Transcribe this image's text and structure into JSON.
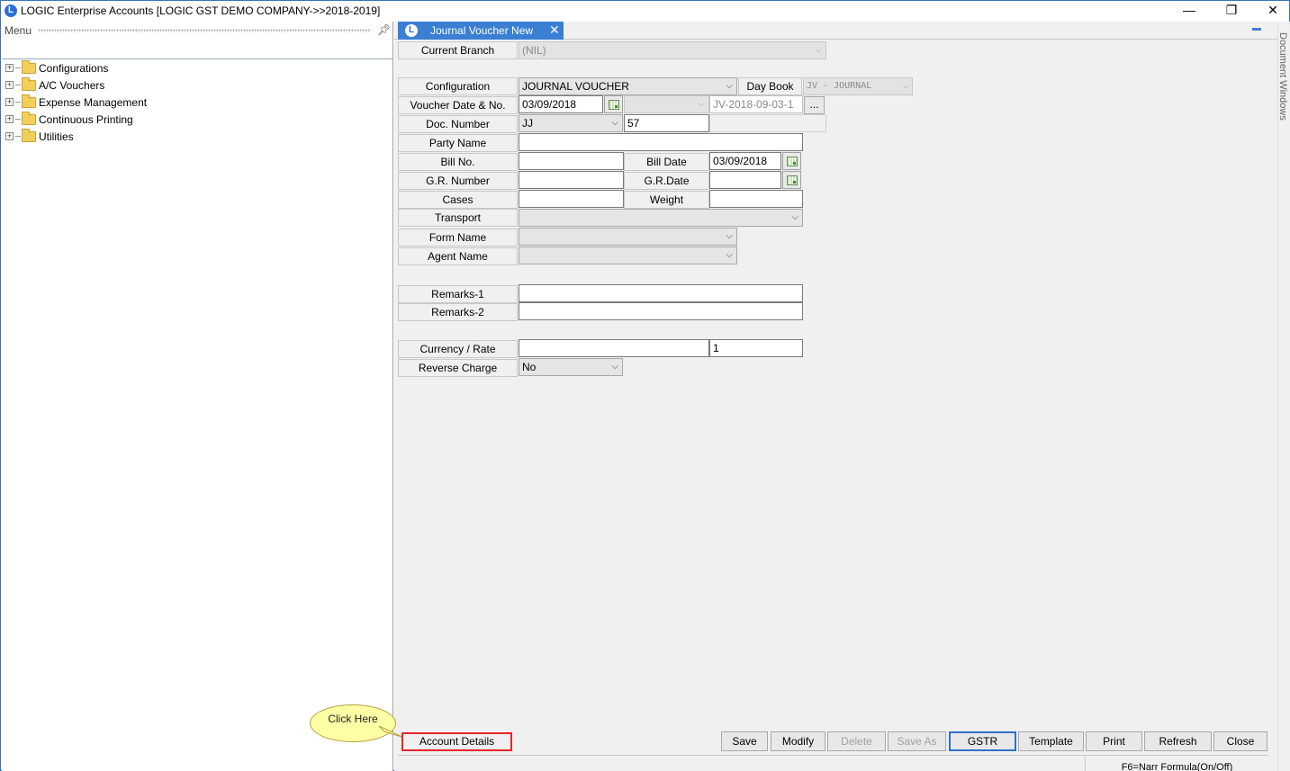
{
  "window": {
    "title": "LOGIC Enterprise Accounts  [LOGIC GST DEMO COMPANY->>2018-2019]",
    "minimize": "—",
    "maximize": "❐",
    "close": "✕"
  },
  "menu": {
    "title": "Menu",
    "items": [
      {
        "label": "Configurations"
      },
      {
        "label": "A/C Vouchers"
      },
      {
        "label": "Expense Management"
      },
      {
        "label": "Continuous Printing"
      },
      {
        "label": "Utilities"
      }
    ]
  },
  "tab": {
    "title": "Journal Voucher New",
    "side_label": "Document Windows"
  },
  "form": {
    "current_branch_label": "Current Branch",
    "current_branch_value": "(NIL)",
    "configuration_label": "Configuration",
    "configuration_value": "JOURNAL VOUCHER",
    "day_book_label": "Day Book",
    "day_book_value": "JV - JOURNAL",
    "voucher_date_label": "Voucher Date & No.",
    "voucher_date_value": "03/09/2018",
    "voucher_no_value": "JV-2018-09-03-1",
    "ellipsis": "...",
    "doc_number_label": "Doc. Number",
    "doc_prefix_value": "JJ",
    "doc_number_value": "57",
    "party_name_label": "Party Name",
    "party_name_value": "",
    "bill_no_label": "Bill No.",
    "bill_no_value": "",
    "bill_date_label": "Bill Date",
    "bill_date_value": "03/09/2018",
    "gr_number_label": "G.R. Number",
    "gr_number_value": "",
    "gr_date_label": "G.R.Date",
    "gr_date_value": "",
    "cases_label": "Cases",
    "cases_value": "",
    "weight_label": "Weight",
    "weight_value": "",
    "transport_label": "Transport",
    "form_name_label": "Form Name",
    "agent_name_label": "Agent Name",
    "remarks1_label": "Remarks-1",
    "remarks1_value": "",
    "remarks2_label": "Remarks-2",
    "remarks2_value": "",
    "currency_label": "Currency / Rate",
    "currency_value": "",
    "rate_value": "1",
    "reverse_charge_label": "Reverse Charge",
    "reverse_charge_value": "No"
  },
  "callout": "Click Here",
  "buttons": {
    "account_details": "Account Details",
    "save": "Save",
    "modify": "Modify",
    "delete": "Delete",
    "save_as": "Save As",
    "gstr": "GSTR",
    "template": "Template",
    "print": "Print",
    "refresh": "Refresh",
    "close": "Close"
  },
  "status": "F6=Narr Formula(On/Off)",
  "colors": {
    "accent": "#3b7fd3",
    "highlight_border": "#e8242a",
    "callout_fill": "#ffffa6"
  }
}
